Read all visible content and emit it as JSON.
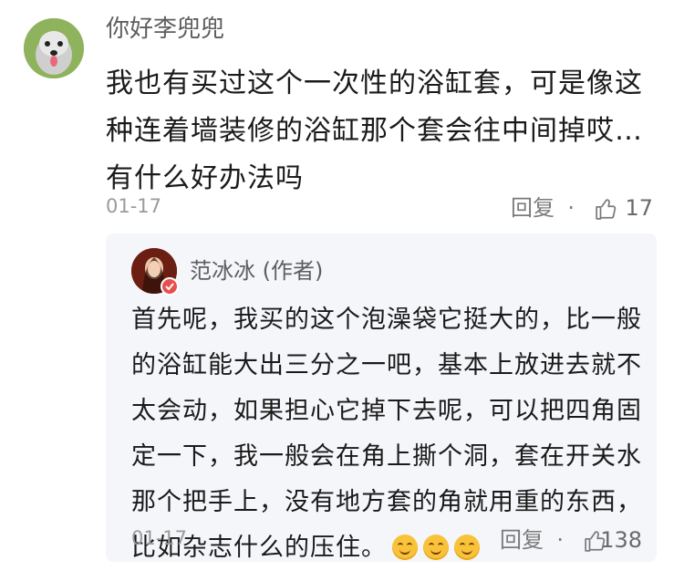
{
  "comment": {
    "username": "你好李兜兜",
    "text": "我也有买过这个一次性的浴缸套，可是像这种连着墙装修的浴缸那个套会往中间掉哎…有什么好办法吗",
    "date": "01-17",
    "reply_label": "回复",
    "separator": "·",
    "like_count": "17"
  },
  "reply": {
    "username": "范冰冰 (作者)",
    "text": "首先呢，我买的这个泡澡袋它挺大的，比一般的浴缸能大出三分之一吧，基本上放进去就不太会动，如果担心它掉下去呢，可以把四角固定一下，我一般会在角上撕个洞，套在开关水那个把手上，没有地方套的角就用重的东西，比如杂志什么的压住。",
    "date": "01-17",
    "reply_label": "回复",
    "separator": "·",
    "like_count": "138",
    "emoji_count": 3
  }
}
